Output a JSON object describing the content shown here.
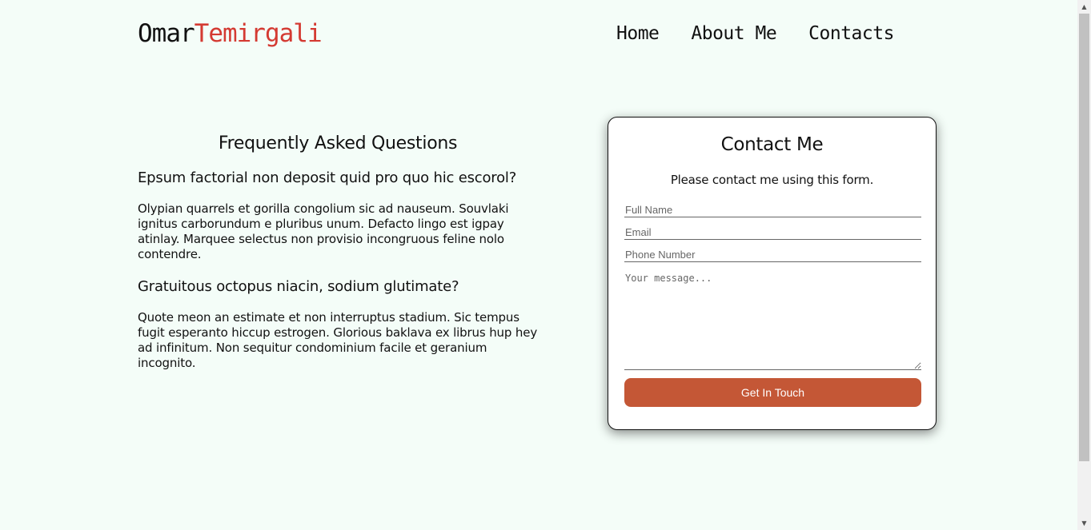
{
  "header": {
    "logo_first": "Omar",
    "logo_last": "Temirgali",
    "nav": [
      {
        "label": "Home"
      },
      {
        "label": "About Me"
      },
      {
        "label": "Contacts"
      }
    ]
  },
  "faq": {
    "title": "Frequently Asked Questions",
    "items": [
      {
        "question": "Epsum factorial non deposit quid pro quo hic escorol?",
        "answer": "Olypian quarrels et gorilla congolium sic ad nauseum. Souvlaki ignitus carborundum e pluribus unum. Defacto lingo est igpay atinlay. Marquee selectus non provisio incongruous feline nolo contendre."
      },
      {
        "question": "Gratuitous octopus niacin, sodium glutimate?",
        "answer": "Quote meon an estimate et non interruptus stadium. Sic tempus fugit esperanto hiccup estrogen. Glorious baklava ex librus hup hey ad infinitum. Non sequitur condominium facile et geranium incognito."
      }
    ]
  },
  "contact": {
    "title": "Contact Me",
    "subtitle": "Please contact me using this form.",
    "full_name_placeholder": "Full Name",
    "email_placeholder": "Email",
    "phone_placeholder": "Phone Number",
    "message_placeholder": "Your message...",
    "submit_label": "Get In Touch"
  },
  "colors": {
    "background": "#f4fdf8",
    "accent": "#d43a32",
    "button": "#c45736"
  },
  "scrollbar": {
    "up_icon": "triangle-up",
    "down_icon": "triangle-down"
  }
}
